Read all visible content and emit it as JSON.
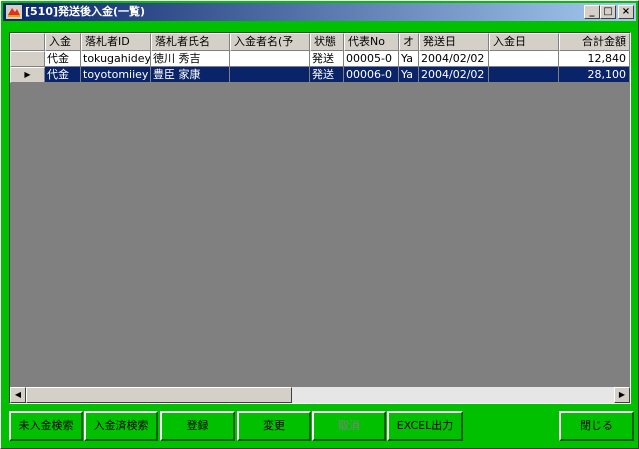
{
  "window": {
    "title": "[510]発送後入金(一覧)"
  },
  "titlebar_buttons": {
    "minimize": "_",
    "maximize": "□",
    "close": "×"
  },
  "grid": {
    "columns": [
      "入金",
      "落札者ID",
      "落札者氏名",
      "入金者名(予",
      "状態",
      "代表No",
      "オ",
      "発送日",
      "入金日",
      "合計金額"
    ],
    "rows": [
      {
        "indicator": "",
        "cells": [
          "代金",
          "tokugahidey",
          "徳川 秀吉",
          "",
          "発送",
          "00005-0",
          "Ya",
          "2004/02/02",
          "",
          "12,840"
        ]
      },
      {
        "indicator": "▶",
        "cells": [
          "代金",
          "toyotomiiey",
          "豊臣 家康",
          "",
          "発送",
          "00006-0",
          "Ya",
          "2004/02/02",
          "",
          "28,100"
        ]
      }
    ],
    "selected_row": 1
  },
  "scrollbar": {
    "left_arrow": "◀",
    "right_arrow": "▶"
  },
  "buttons": {
    "search_unpaid": "未入金検索",
    "search_paid": "入金済検索",
    "register": "登録",
    "change": "変更",
    "cancel": "取消",
    "excel_export": "EXCEL出力",
    "close": "閉じる"
  },
  "colors": {
    "form_background": "#00c000",
    "selection": "#0a246a",
    "titlebar": "#0a246a"
  }
}
